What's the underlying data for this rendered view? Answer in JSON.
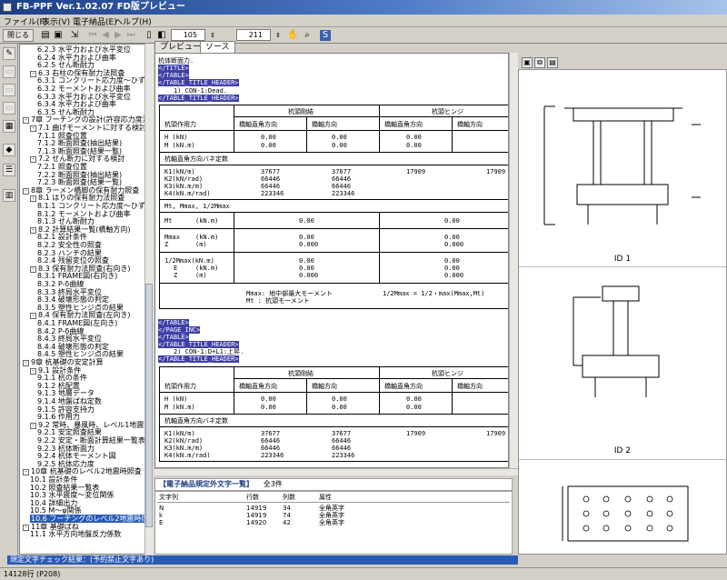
{
  "window": {
    "title": "FB-PPF Ver.1.02.07 FD版プレビュー"
  },
  "menu": [
    "ファイル(F)",
    "表示(V)",
    "電子納品(E)",
    "ヘルプ(H)"
  ],
  "toolbar": {
    "close_label": "閉じる",
    "zoom_value": "105",
    "page_value": "211"
  },
  "tree": {
    "items": [
      {
        "t": "6.2.3 水平力および水平変位",
        "l": 4
      },
      {
        "t": "6.2.4 水平力および曲率",
        "l": 4
      },
      {
        "t": "6.2.5 せん断耐力",
        "l": 4
      },
      {
        "t": "6.3 右柱の保有耐力法照査",
        "l": 2,
        "pm": "-"
      },
      {
        "t": "6.3.1 コンクリート応力度〜ひず",
        "l": 4
      },
      {
        "t": "6.3.2 モーメントおよび曲率",
        "l": 4
      },
      {
        "t": "6.3.3 水平力および水平変位",
        "l": 4
      },
      {
        "t": "6.3.4 水平力および曲率",
        "l": 4
      },
      {
        "t": "6.3.5 せん断耐力",
        "l": 4
      },
      {
        "t": "7章 フーチングの設計(許容応力度法)",
        "l": 0,
        "pm": "-"
      },
      {
        "t": "7.1 曲げモーメントに対する検討",
        "l": 2,
        "pm": "-"
      },
      {
        "t": "7.1.1 照査位置",
        "l": 4
      },
      {
        "t": "7.1.2 断面照査(抽出結果)",
        "l": 4
      },
      {
        "t": "7.1.3 断面照査(結果一覧)",
        "l": 4
      },
      {
        "t": "7.2 せん断力に対する検討",
        "l": 2,
        "pm": "-"
      },
      {
        "t": "7.2.1 照査位置",
        "l": 4
      },
      {
        "t": "7.2.2 断面照査(抽出結果)",
        "l": 4
      },
      {
        "t": "7.2.3 断面照査(結果一覧)",
        "l": 4
      },
      {
        "t": "8章 ラーメン橋脚の保有耐力照査",
        "l": 0,
        "pm": "-"
      },
      {
        "t": "8.1 はりの保有耐力法照査",
        "l": 2,
        "pm": "-"
      },
      {
        "t": "8.1.1 コンクリート応力度〜ひず",
        "l": 4
      },
      {
        "t": "8.1.2 モーメントおよび曲率",
        "l": 4
      },
      {
        "t": "8.1.3 せん断耐力",
        "l": 4
      },
      {
        "t": "8.2 計算結果一覧(橋軸方向)",
        "l": 2,
        "pm": "-"
      },
      {
        "t": "8.2.1 設計条件",
        "l": 4
      },
      {
        "t": "8.2.2 安全性の照査",
        "l": 4
      },
      {
        "t": "8.2.3 ハンチの結果",
        "l": 4
      },
      {
        "t": "8.2.4 残留変位の照査",
        "l": 4
      },
      {
        "t": "8.3 保有耐力法照査(右向き)",
        "l": 2,
        "pm": "-"
      },
      {
        "t": "8.3.1 FRAME図(右向き)",
        "l": 4
      },
      {
        "t": "8.3.2 P-δ曲線",
        "l": 4
      },
      {
        "t": "8.3.3 終局水平変位",
        "l": 4
      },
      {
        "t": "8.3.4 破壊形態の判定",
        "l": 4
      },
      {
        "t": "8.3.5 塑性ヒンジ点の結果",
        "l": 4
      },
      {
        "t": "8.4 保有耐力法照査(左向き)",
        "l": 2,
        "pm": "-"
      },
      {
        "t": "8.4.1 FRAME図(左向き)",
        "l": 4
      },
      {
        "t": "8.4.2 P-δ曲線",
        "l": 4
      },
      {
        "t": "8.4.3 終局水平変位",
        "l": 4
      },
      {
        "t": "8.4.4 破壊形態の判定",
        "l": 4
      },
      {
        "t": "8.4.5 塑性ヒンジ点の結果",
        "l": 4
      },
      {
        "t": "9章 杭基礎の安定計算",
        "l": 0,
        "pm": "-"
      },
      {
        "t": "9.1 設計条件",
        "l": 2,
        "pm": "-"
      },
      {
        "t": "9.1.1 杭の条件",
        "l": 4
      },
      {
        "t": "9.1.2 杭配置",
        "l": 4
      },
      {
        "t": "9.1.3 地層データ",
        "l": 4
      },
      {
        "t": "9.1.4 地盤ばね定数",
        "l": 4
      },
      {
        "t": "9.1.5 許容支持力",
        "l": 4
      },
      {
        "t": "9.1.6 作用力",
        "l": 4
      },
      {
        "t": "9.2 常時、暴風時、レベル1地震時の",
        "l": 2,
        "pm": "-"
      },
      {
        "t": "9.2.1 安定照査結果",
        "l": 4
      },
      {
        "t": "9.2.2 安定・断面計算結果一覧表",
        "l": 4
      },
      {
        "t": "9.2.3 杭体断面力",
        "l": 4
      },
      {
        "t": "9.2.4 杭体モーメント図",
        "l": 4
      },
      {
        "t": "9.2.5 杭体応力度",
        "l": 4
      },
      {
        "t": "10章 杭基礎のレベル2地震時照査",
        "l": 0,
        "pm": "-"
      },
      {
        "t": "10.1 設計条件",
        "l": 2
      },
      {
        "t": "10.2 照査結果一覧表",
        "l": 2
      },
      {
        "t": "10.3 水平震度〜変位関係",
        "l": 2
      },
      {
        "t": "10.4 詳細出力",
        "l": 2
      },
      {
        "t": "10.5 M〜φ関係",
        "l": 2
      },
      {
        "t": "10.6 フーチングのレベル2地震時照",
        "l": 2,
        "sel": true
      },
      {
        "t": "11章 基礎ばね",
        "l": 0,
        "pm": "-"
      },
      {
        "t": "11.1 水平方向地盤反力係数",
        "l": 2
      }
    ]
  },
  "tabs": [
    "プレビュー",
    "ソース"
  ],
  "source": {
    "heading": "杭体断面力.",
    "block1_tags": [
      "</TITLE>",
      "</TABLE>",
      "</TABLE_TITLE_HEADER>"
    ],
    "case1_label": "1) CON-1:Dead.",
    "case1_close": "</TABLE_TITLE_HEADER>",
    "block2_tags": [
      "</TABLE>",
      "</PAGE_INC>",
      "</TABLE>",
      "</TABLE_TITLE_HEADER>"
    ],
    "case2_label": "2) CON-1:D+L1:上昇.",
    "case2_close": "</TABLE_TITLE_HEADER>"
  },
  "table": {
    "col_force": "杭頭作用力",
    "col_rigid": "杭頭剛結",
    "col_hinge": "杭頭ヒンジ",
    "sub_perp": "橋軸直角方向",
    "sub_axis": "橋軸方向",
    "H": "H (kN)",
    "M": "M (kN.m)",
    "zeros": "0.00",
    "spring_hdr": "杭軸直角方向バネ定数",
    "k1": "K1(kN/m)",
    "k2": "K2(kN/rad)",
    "k3": "K3(kN.m/m)",
    "k4": "K4(kN.m/rad)",
    "r_k1": "37677",
    "r_k2": "66446",
    "r_k3": "66446",
    "r_k4": "223346",
    "h_k1": "17909",
    "mt_hdr": "Mt, Mmax, 1/2Mmax",
    "mt": "Mt",
    "mmax": "Mmax",
    "z": "Z",
    "half": "1/2Mmax(kN.m)",
    "e": "E",
    "unit_knm": "(kN.m)",
    "unit_m": "(m)",
    "val_000": "0.00",
    "val_0000": "0.000",
    "note1": "Mmax: 地中部最大モーメント",
    "note1b": "1/2Mmax = 1/2・max(Mmax,Mt)",
    "note2": "Mt : 杭頭モーメント"
  },
  "bottom": {
    "header": "【電子納品規定外文字一覧】",
    "count": "全3件",
    "columns": [
      "文字列",
      "行数",
      "列数",
      "属性"
    ],
    "rows": [
      [
        "N",
        "14919",
        "34",
        "全角英字"
      ],
      [
        "k",
        "14919",
        "74",
        "全角英字"
      ],
      [
        "E",
        "14920",
        "42",
        "全角英字"
      ]
    ]
  },
  "preview": {
    "ids": [
      "ID 1",
      "ID 2"
    ]
  },
  "status": {
    "message": "規定文字チェック結果：(予約禁止文字あり)",
    "position": "14128行 (P208)"
  }
}
